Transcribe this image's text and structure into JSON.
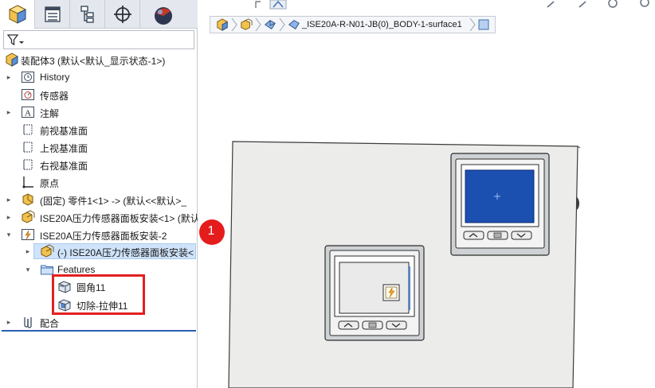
{
  "tabs": [
    {
      "name": "feature-manager",
      "icon": "assembly-icon"
    },
    {
      "name": "property-manager",
      "icon": "property-list-icon"
    },
    {
      "name": "configuration-manager",
      "icon": "configuration-icon"
    },
    {
      "name": "dimxpert-manager",
      "icon": "crosshair-icon"
    },
    {
      "name": "display-manager",
      "icon": "appearance-sphere-icon"
    }
  ],
  "filter": {
    "icon": "filter-icon"
  },
  "tree": {
    "root_label": "装配体3 (默认<默认_显示状态-1>)",
    "items": [
      {
        "label": "History",
        "icon": "history-icon"
      },
      {
        "label": "传感器",
        "icon": "sensor-icon"
      },
      {
        "label": "注解",
        "icon": "annotation-icon"
      },
      {
        "label": "前视基准面",
        "icon": "plane-icon"
      },
      {
        "label": "上视基准面",
        "icon": "plane-icon"
      },
      {
        "label": "右视基准面",
        "icon": "plane-icon"
      },
      {
        "label": "原点",
        "icon": "origin-icon"
      },
      {
        "label": "(固定) 零件1<1> -> (默认<<默认>_",
        "icon": "part-icon"
      },
      {
        "label": "ISE20A压力传感器面板安装<1> (默认",
        "icon": "subassembly-icon"
      },
      {
        "label": "ISE20A压力传感器面板安装-2",
        "icon": "virtual-part-icon"
      },
      {
        "label": "(-) ISE20A压力传感器面板安装<",
        "icon": "subassembly-icon"
      },
      {
        "label": "Features",
        "icon": "folder-icon"
      },
      {
        "label": "圆角11",
        "icon": "fillet-icon"
      },
      {
        "label": "切除-拉伸11",
        "icon": "cut-extrude-icon"
      },
      {
        "label": "配合",
        "icon": "mates-icon"
      }
    ]
  },
  "breadcrumb": {
    "path_text": "_ISE20A-R-N01-JB(0)_BODY-1-surface1"
  },
  "callout": {
    "number": "1"
  },
  "colors": {
    "selection": "#cfe3fa",
    "highlight": "#e32020",
    "callout": "#e51c1c",
    "display_screen": "#1b4fb0"
  }
}
